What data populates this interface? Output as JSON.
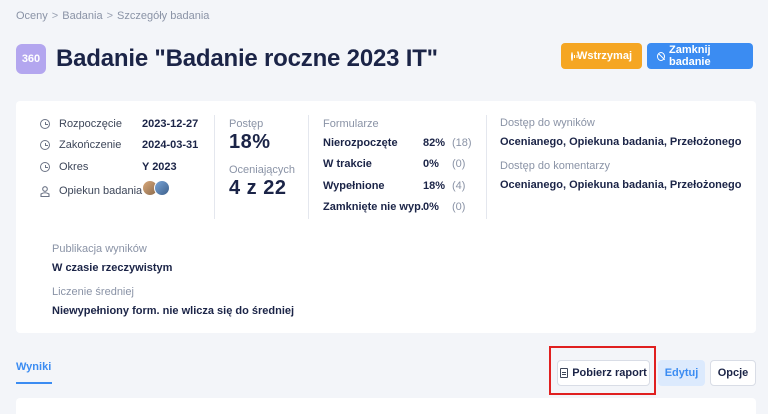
{
  "breadcrumb": {
    "items": [
      "Oceny",
      "Badania",
      "Szczegóły badania"
    ],
    "separator": ">"
  },
  "header": {
    "badge": "360",
    "title": "Badanie \"Badanie roczne 2023 IT\"",
    "pause_label": "Wstrzymaj",
    "close_label": "Zamknij badanie"
  },
  "details": {
    "start_label": "Rozpoczęcie",
    "start_value": "2023-12-27",
    "end_label": "Zakończenie",
    "end_value": "2024-03-31",
    "period_label": "Okres",
    "period_value": "Y 2023",
    "owner_label": "Opiekun badania"
  },
  "progress": {
    "progress_label": "Postęp",
    "progress_value": "18%",
    "evaluated_label": "Oceniających",
    "evaluated_value": "4 z 22"
  },
  "forms": {
    "heading": "Formularze",
    "rows": [
      {
        "label": "Nierozpoczęte",
        "pct": "82%",
        "count": "(18)"
      },
      {
        "label": "W trakcie",
        "pct": "0%",
        "count": "(0)"
      },
      {
        "label": "Wypełnione",
        "pct": "18%",
        "count": "(4)"
      },
      {
        "label": "Zamknięte nie wyp.",
        "pct": "0%",
        "count": "(0)"
      }
    ]
  },
  "access": {
    "results_label": "Dostęp do wyników",
    "results_value": "Ocenianego, Opiekuna badania, Przełożonego",
    "comments_label": "Dostęp do komentarzy",
    "comments_value": "Ocenianego, Opiekuna badania, Przełożonego"
  },
  "publication": {
    "label": "Publikacja wyników",
    "value": "W czasie rzeczywistym",
    "avg_label": "Liczenie średniej",
    "avg_value": "Niewypełniony form. nie wlicza się do średniej"
  },
  "tabs": {
    "results": "Wyniki"
  },
  "actions": {
    "report": "Pobierz raport",
    "edit": "Edytuj",
    "options": "Opcje"
  },
  "colors": {
    "accent": "#3b8cf2",
    "warning": "#f5a623",
    "badge": "#b3a6ef",
    "highlight": "#e02020"
  }
}
